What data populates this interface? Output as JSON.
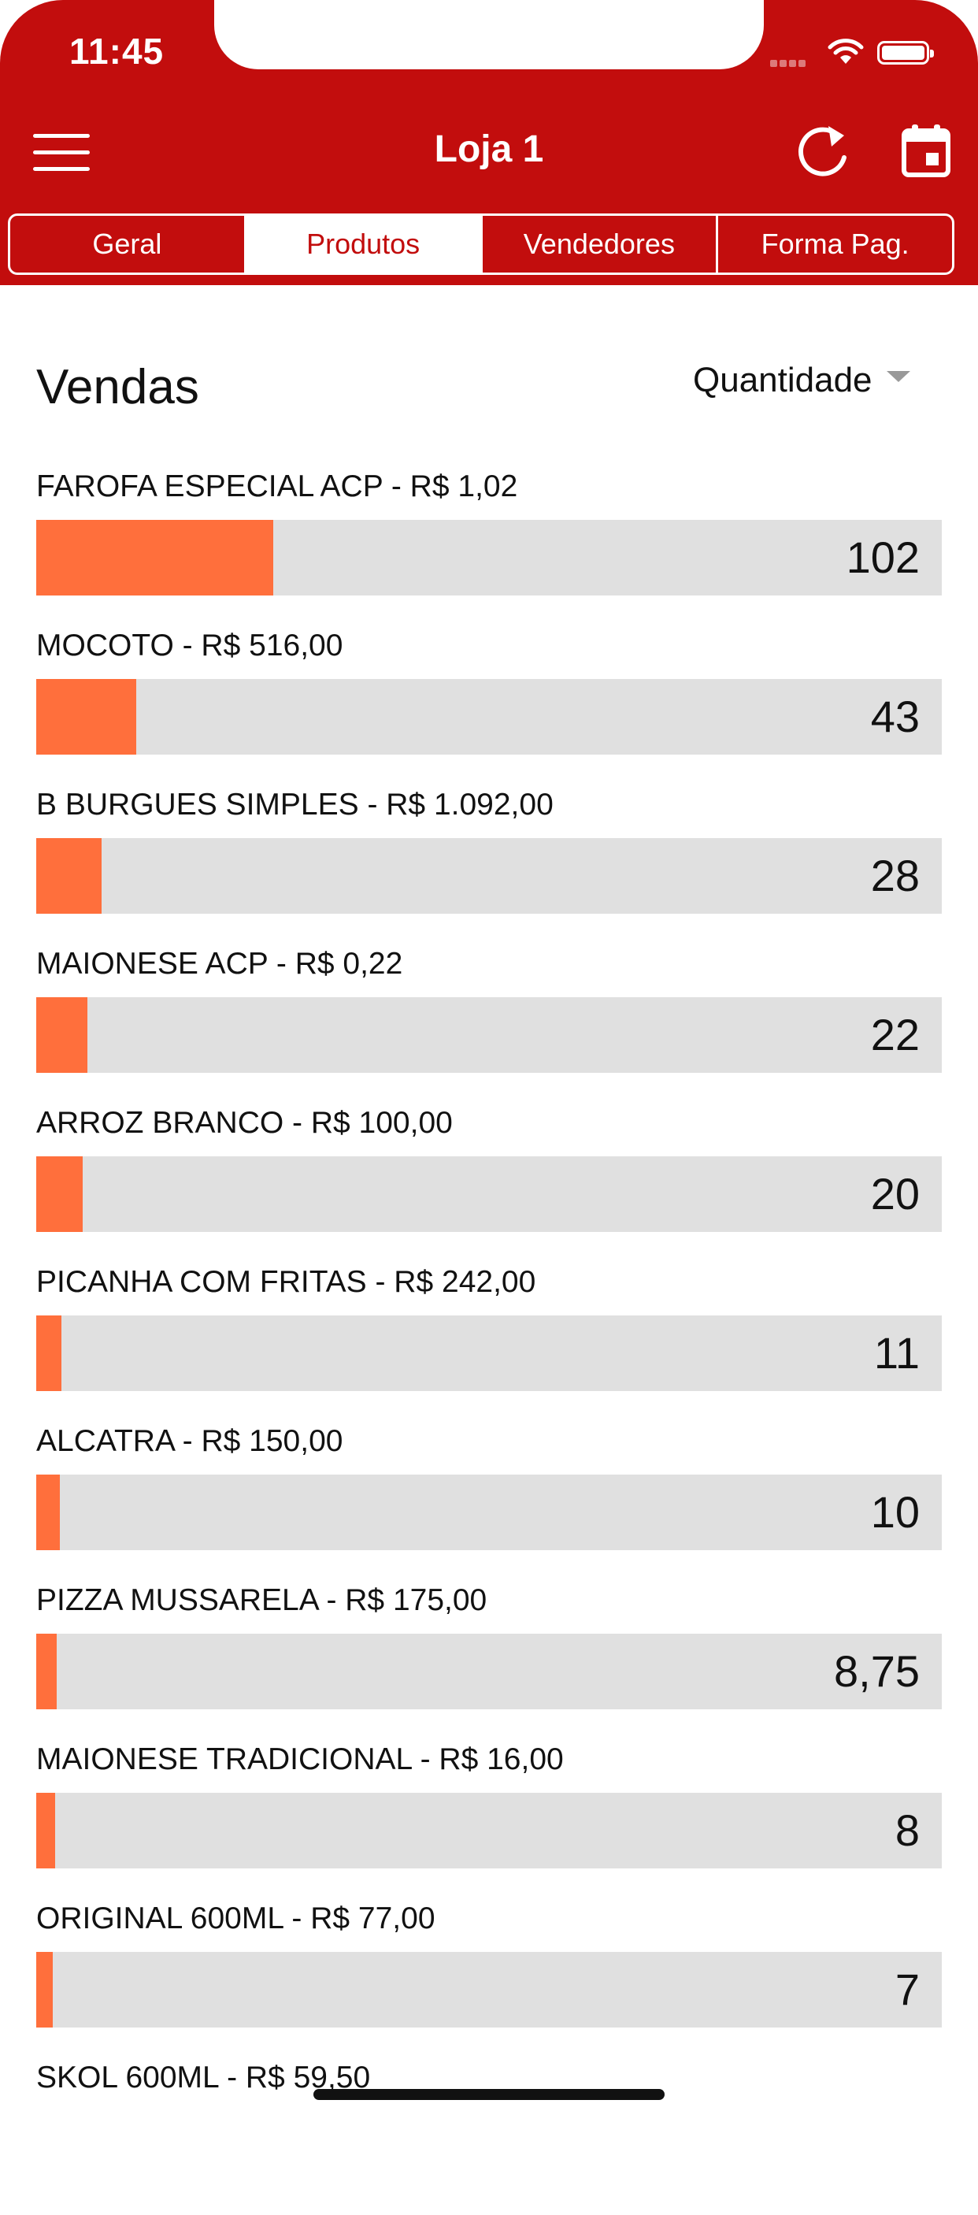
{
  "status_bar": {
    "time": "11:45"
  },
  "header": {
    "title": "Loja 1"
  },
  "tabs": [
    {
      "label": "Geral",
      "active": false
    },
    {
      "label": "Produtos",
      "active": true
    },
    {
      "label": "Vendedores",
      "active": false
    },
    {
      "label": "Forma Pag.",
      "active": false
    }
  ],
  "section": {
    "title": "Vendas",
    "sort_label": "Quantidade"
  },
  "colors": {
    "header": "#c20d0d",
    "bar_fill": "#ff6f3c",
    "bar_track": "#e0e0e0"
  },
  "items": [
    {
      "label": "FAROFA ESPECIAL ACP - R$ 1,02",
      "value": "102",
      "quantity": 102
    },
    {
      "label": "MOCOTO - R$ 516,00",
      "value": "43",
      "quantity": 43
    },
    {
      "label": "B BURGUES SIMPLES - R$ 1.092,00",
      "value": "28",
      "quantity": 28
    },
    {
      "label": "MAIONESE ACP - R$ 0,22",
      "value": "22",
      "quantity": 22
    },
    {
      "label": "ARROZ BRANCO - R$ 100,00",
      "value": "20",
      "quantity": 20
    },
    {
      "label": "PICANHA COM FRITAS - R$ 242,00",
      "value": "11",
      "quantity": 11
    },
    {
      "label": "ALCATRA - R$ 150,00",
      "value": "10",
      "quantity": 10
    },
    {
      "label": "PIZZA MUSSARELA - R$ 175,00",
      "value": "8,75",
      "quantity": 8.75
    },
    {
      "label": "MAIONESE TRADICIONAL - R$ 16,00",
      "value": "8",
      "quantity": 8
    },
    {
      "label": "ORIGINAL 600ML - R$ 77,00",
      "value": "7",
      "quantity": 7
    },
    {
      "label": "SKOL 600ML - R$ 59,50",
      "value": "",
      "quantity": null
    }
  ]
}
